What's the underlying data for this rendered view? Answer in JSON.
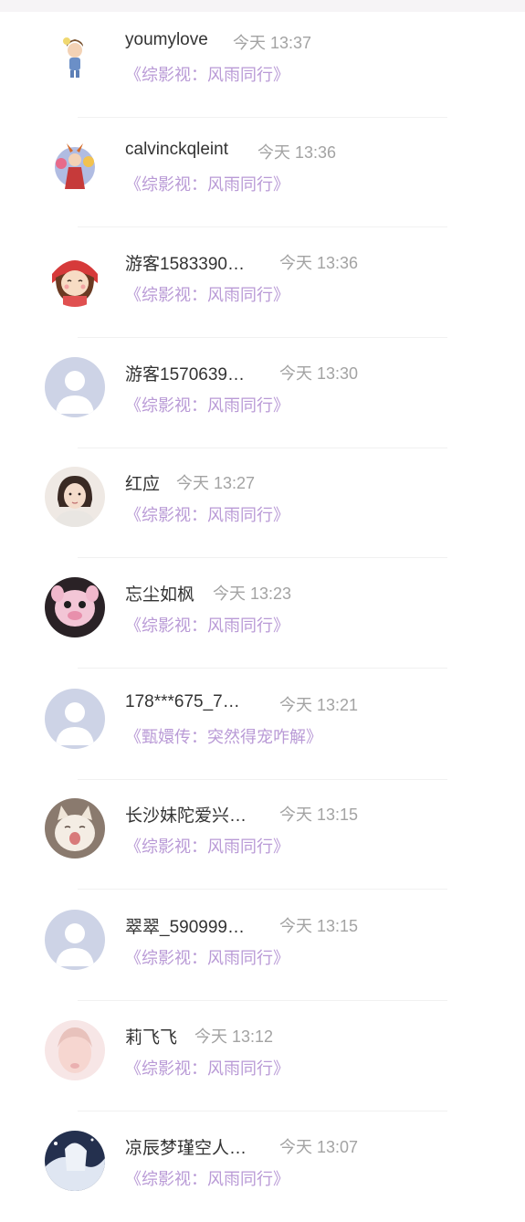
{
  "records": [
    {
      "name": "youmylove",
      "time": "今天 13:37",
      "book": "《综影视：风雨同行》",
      "avatar": "cartoon-girl-avatar"
    },
    {
      "name": "calvinckqleint",
      "time": "今天 13:36",
      "book": "《综影视：风雨同行》",
      "avatar": "floral-character-avatar"
    },
    {
      "name": "游客1583390…",
      "time": "今天 13:36",
      "book": "《综影视：风雨同行》",
      "avatar": "red-hat-girl-avatar"
    },
    {
      "name": "游客1570639…",
      "time": "今天 13:30",
      "book": "《综影视：风雨同行》",
      "avatar": "default-user-avatar"
    },
    {
      "name": "红应",
      "time": "今天 13:27",
      "book": "《综影视：风雨同行》",
      "avatar": "photo-girl-avatar"
    },
    {
      "name": "忘尘如枫",
      "time": "今天 13:23",
      "book": "《综影视：风雨同行》",
      "avatar": "pink-animal-avatar"
    },
    {
      "name": "178***675_7…",
      "time": "今天 13:21",
      "book": "《甄嬛传：突然得宠咋解》",
      "avatar": "default-user-avatar"
    },
    {
      "name": "长沙妹陀爱兴…",
      "time": "今天 13:15",
      "book": "《综影视：风雨同行》",
      "avatar": "cat-avatar"
    },
    {
      "name": "翠翠_590999…",
      "time": "今天 13:15",
      "book": "《综影视：风雨同行》",
      "avatar": "default-user-avatar"
    },
    {
      "name": "莉飞飞",
      "time": "今天 13:12",
      "book": "《综影视：风雨同行》",
      "avatar": "blurred-face-avatar"
    },
    {
      "name": "凉辰梦瑾空人…",
      "time": "今天 13:07",
      "book": "《综影视：风雨同行》",
      "avatar": "anime-winter-avatar"
    }
  ],
  "colors": {
    "name": "#333333",
    "time": "#a3a3a3",
    "book": "#b99ad6",
    "default_avatar_bg": "#cdd3e6"
  }
}
